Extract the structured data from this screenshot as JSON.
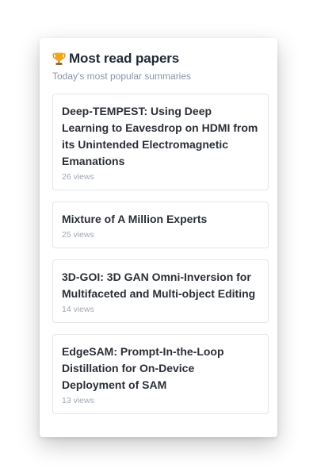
{
  "header": {
    "title": "Most read papers",
    "subtitle": "Today's most popular summaries",
    "icon": "trophy-icon",
    "icon_color": "#f0a818"
  },
  "papers": [
    {
      "title": "Deep-TEMPEST: Using Deep Learning to Eavesdrop on HDMI from its Unintended Electromagnetic Emanations",
      "views": "26 views"
    },
    {
      "title": "Mixture of A Million Experts",
      "views": "25 views"
    },
    {
      "title": "3D-GOI: 3D GAN Omni-Inversion for Multifaceted and Multi-object Editing",
      "views": "14 views"
    },
    {
      "title": "EdgeSAM: Prompt-In-the-Loop Distillation for On-Device Deployment of SAM",
      "views": "13 views"
    }
  ]
}
